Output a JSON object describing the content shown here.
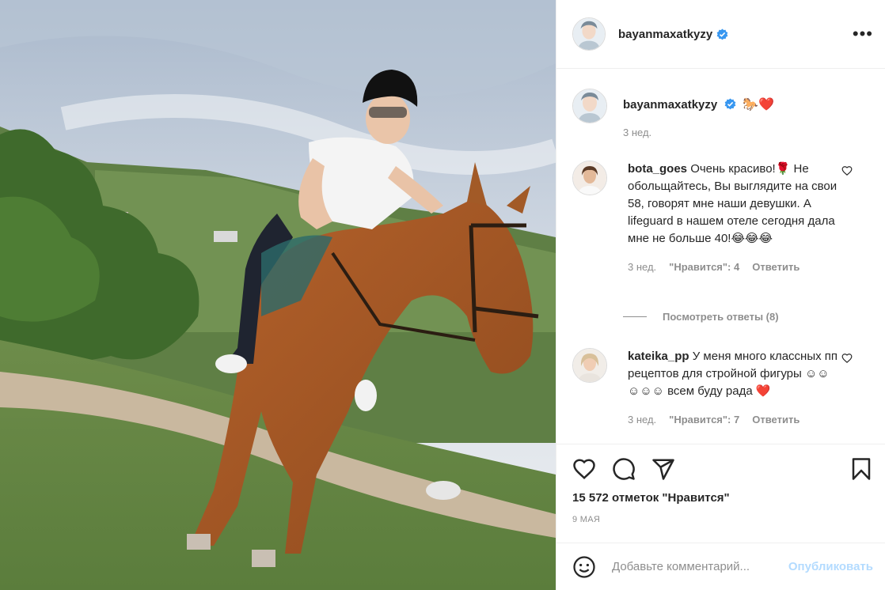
{
  "post": {
    "username": "bayanmaxatkyzy",
    "more_icon": "more-horizontal-icon",
    "accent_color": "#0095f6"
  },
  "caption": {
    "username": "bayanmaxatkyzy",
    "emojis": "🐎❤️",
    "time": "3 нед."
  },
  "comments": [
    {
      "username": "bota_goes",
      "text": "Очень красиво!🌹 Не обольщайтесь, Вы выглядите на свои 58, говорят мне наши девушки. А lifeguard в нашем отеле сегодня дала мне не больше 40!😂😂😂",
      "time": "3 нед.",
      "likes": "\"Нравится\": 4",
      "reply": "Ответить"
    },
    {
      "username": "kateika_pp",
      "text": "У меня много классных пп рецептов для стройной фигуры ☺☺☺☺☺ всем буду рада ❤️",
      "time": "3 нед.",
      "likes": "\"Нравится\": 7",
      "reply": "Ответить"
    }
  ],
  "view_replies": "Посмотреть ответы (8)",
  "likes_count": "15 572 отметок \"Нравится\"",
  "date": "9 МАЯ",
  "add_comment": {
    "placeholder": "Добавьте комментарий...",
    "post_label": "Опубликовать"
  }
}
